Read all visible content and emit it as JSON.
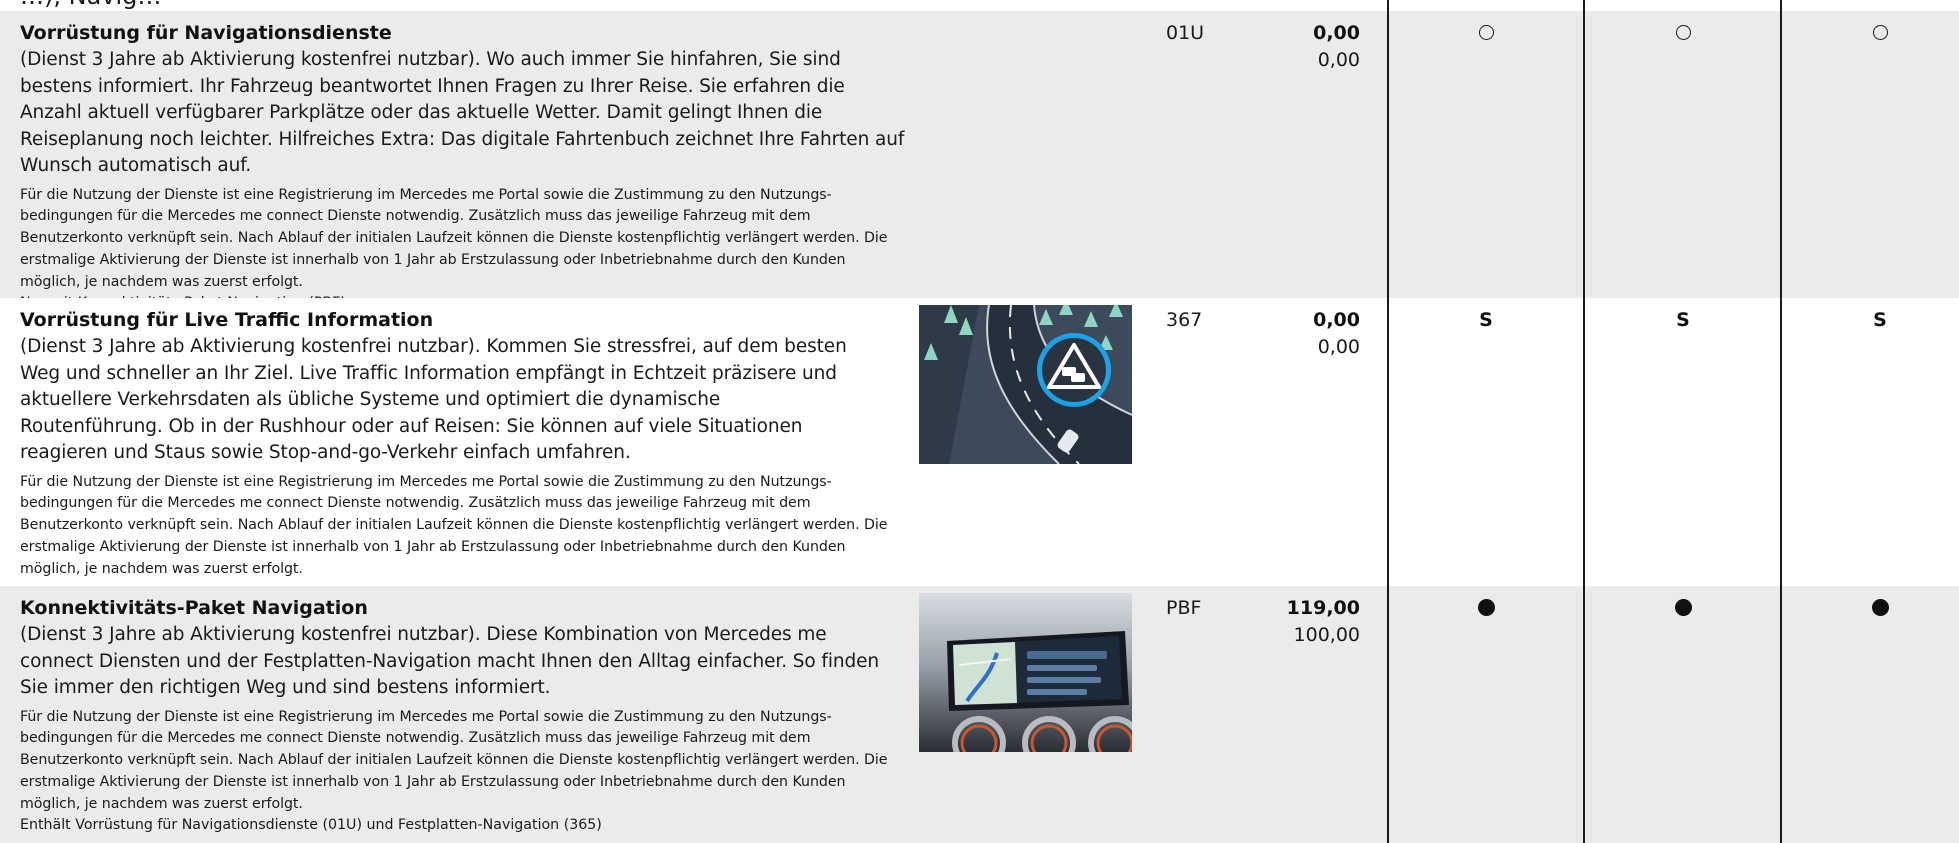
{
  "top_fragment": "…), Navig…",
  "rows": [
    {
      "title": "Vorrüstung für Navigationsdienste",
      "lead": "(Dienst 3 Jahre ab Aktivierung kostenfrei nutzbar). Wo auch immer Sie hinfahren, Sie sind bestens informiert. Ihr Fahrzeug beantwortet Ihnen Fragen zu Ihrer Reise. Sie erfahren die Anzahl aktuell verfügbarer Parkplätze oder das aktuelle Wetter. Damit gelingt Ihnen die Reiseplanung noch leichter. Hilfreiches Extra: Das digitale Fahrtenbuch zeichnet Ihre Fahrten auf Wunsch automatisch auf.",
      "fine": "Für die Nutzung der Dienste ist eine Registrierung im Mercedes me Portal sowie die Zustimmung zu den Nutzungs­bedingungen für die Mercedes me connect Dienste notwendig. Zusätzlich muss das jeweilige Fahrzeug mit dem Benutzerkonto verknüpft sein. Nach Ablauf der initialen Laufzeit können die Dienste kostenpflichtig verlängert werden. Die erstmalige Aktivierung der Dienste ist innerhalb von 1 Jahr ab Erstzulassung oder Inbetriebnahme durch den Kunden möglich, je nachdem was zuerst erfolgt.",
      "note": "Nur mit Konnektivitäts-Paket Navigation (PBF)",
      "code": "01U",
      "price": "0,00",
      "price_net": "0,00",
      "availability": [
        "○",
        "○",
        "○"
      ]
    },
    {
      "title": "Vorrüstung für Live Traffic Information",
      "lead": "(Dienst 3 Jahre ab Aktivierung kostenfrei nutzbar). Kommen Sie stressfrei, auf dem besten Weg und schneller an Ihr Ziel. Live Traffic Information empfängt in Echtzeit präzisere und aktuellere Verkehrsdaten als übliche Systeme und optimiert die dynamische Routenführung. Ob in der Rushhour oder auf Reisen: Sie können auf viele Situationen reagieren und Staus sowie Stop-and-go-Verkehr einfach umfahren.",
      "fine": "Für die Nutzung der Dienste ist eine Registrierung im Mercedes me Portal sowie die Zustimmung zu den Nutzungs­bedingungen für die Mercedes me connect Dienste notwendig. Zusätzlich muss das jeweilige Fahrzeug mit dem Benutzerkonto verknüpft sein. Nach Ablauf der initialen Laufzeit können die Dienste kostenpflichtig verlängert werden. Die erstmalige Aktivierung der Dienste ist innerhalb von 1 Jahr ab Erstzulassung oder Inbetriebnahme durch den Kunden möglich, je nachdem was zuerst erfolgt.",
      "note": "",
      "code": "367",
      "price": "0,00",
      "price_net": "0,00",
      "availability": [
        "S",
        "S",
        "S"
      ]
    },
    {
      "title": "Konnektivitäts-Paket Navigation",
      "lead": "(Dienst 3 Jahre ab Aktivierung kostenfrei nutzbar). Diese Kombination von Mercedes me connect Diensten und der Festplatten-Navigation macht Ihnen den Alltag einfacher. So finden Sie immer den richtigen Weg und sind bestens informiert.",
      "fine": "Für die Nutzung der Dienste ist eine Registrierung im Mercedes me Portal sowie die Zustimmung zu den Nutzungs­bedingungen für die Mercedes me connect Dienste notwendig. Zusätzlich muss das jeweilige Fahrzeug mit dem Benutzerkonto verknüpft sein. Nach Ablauf der initialen Laufzeit können die Dienste kostenpflichtig verlängert werden. Die erstmalige Aktivierung der Dienste ist innerhalb von 1 Jahr ab Erstzulassung oder Inbetriebnahme durch den Kunden möglich, je nachdem was zuerst erfolgt.",
      "note": "Enthält Vorrüstung für Navigationsdienste (01U) und Festplatten-Navigation (365)",
      "code": "PBF",
      "price": "119,00",
      "price_net": "100,00",
      "availability": [
        "●",
        "●",
        "●"
      ]
    }
  ],
  "colors": {
    "shaded_row": "#ebebeb",
    "text": "#1a1a1a",
    "traffic_icon_ring": "#1aa3e8"
  },
  "icons": [
    "traffic-jam-icon",
    "car-icon"
  ]
}
